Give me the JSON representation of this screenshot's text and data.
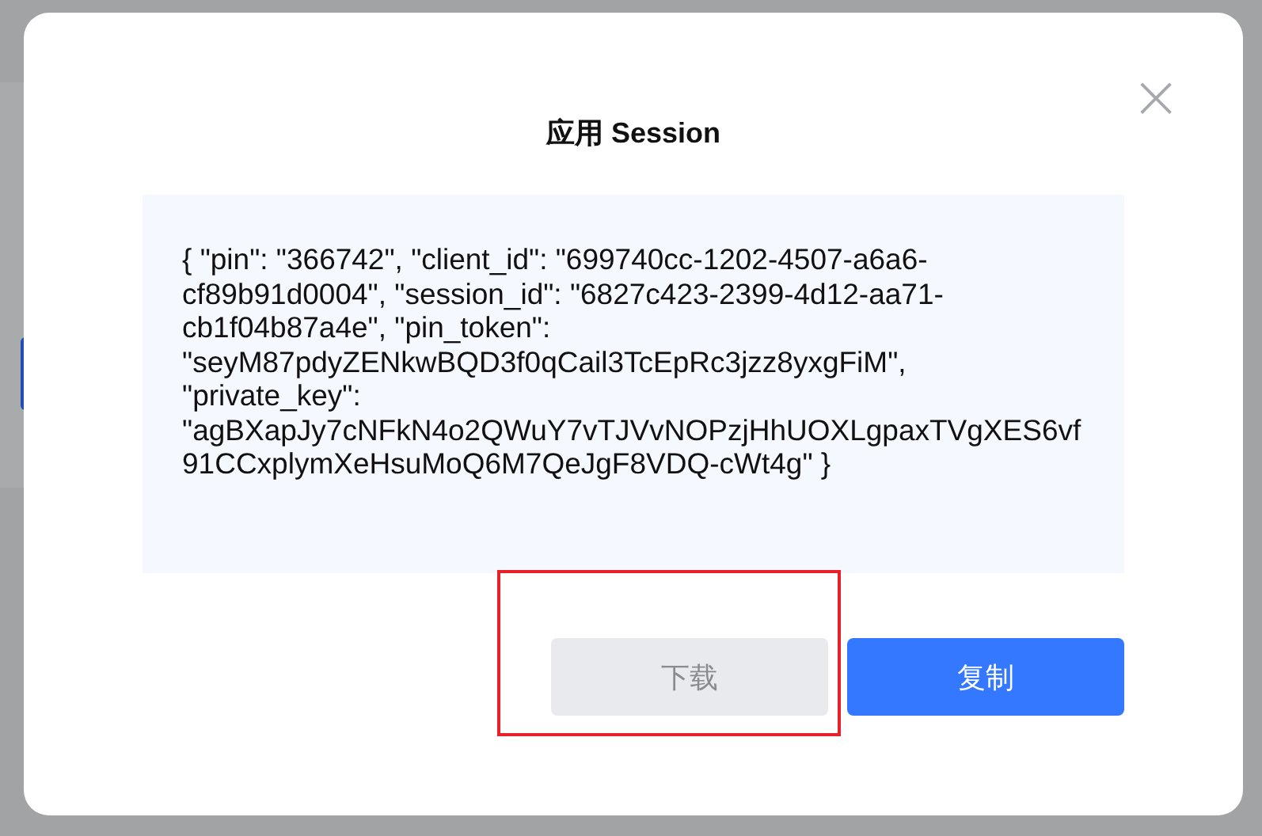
{
  "dialog": {
    "title": "应用 Session",
    "close_icon": "×",
    "content": "{ \"pin\": \"366742\", \"client_id\": \"699740cc-1202-4507-a6a6-cf89b91d0004\", \"session_id\": \"6827c423-2399-4d12-aa71-cb1f04b87a4e\", \"pin_token\": \"seyM87pdyZENkwBQD3f0qCail3TcEpRc3jzz8yxgFiM\", \"private_key\": \"agBXapJy7cNFkN4o2QWuY7vTJVvNOPzjHhUOXLgpaxTVgXES6vf91CCxplymXeHsuMoQ6M7QeJgF8VDQ-cWt4g\" }",
    "buttons": [
      {
        "label": "下载",
        "kind": "secondary",
        "disabled": true,
        "highlighted": true
      },
      {
        "label": "复制",
        "kind": "primary",
        "disabled": false,
        "highlighted": false
      }
    ]
  }
}
